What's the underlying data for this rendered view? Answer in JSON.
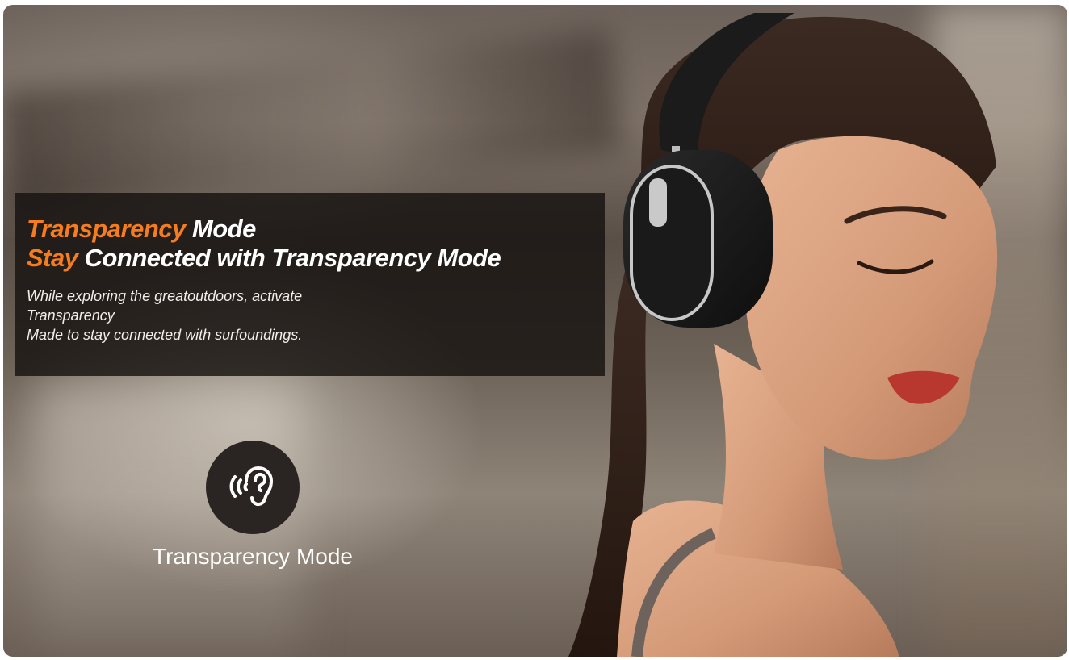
{
  "headline": {
    "line1_accent": "Transparency",
    "line1_rest": " Mode",
    "line2_accent": "Stay",
    "line2_rest": " Connected with Transparency Mode"
  },
  "description": {
    "lines": [
      "While exploring the greatoutdoors, activate",
      "Transparency",
      "Made to stay connected with surfoundings."
    ]
  },
  "mode_badge": {
    "icon": "ear-sound-icon",
    "label": "Transparency Mode"
  },
  "colors": {
    "accent": "#f57c1f",
    "panel": "#16120f",
    "text": "#ffffff"
  }
}
